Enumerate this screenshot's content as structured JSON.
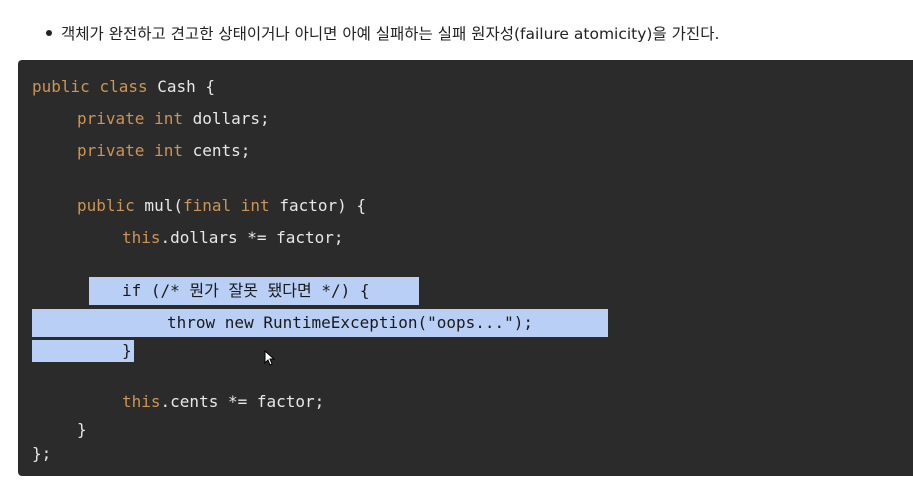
{
  "bullet": {
    "text": "객체가 완전하고 견고한 상태이거나 아니면 아예 실패하는 실패 원자성(failure atomicity)을 가진다."
  },
  "code": {
    "line1": {
      "kw1": "public",
      "kw2": "class",
      "rest": " Cash {"
    },
    "line2": {
      "kw1": "private",
      "kw2": "int",
      "rest": " dollars;"
    },
    "line3": {
      "kw1": "private",
      "kw2": "int",
      "rest": " cents;"
    },
    "line4": {
      "kw1": "public",
      "rest1": " mul(",
      "kw2": "final",
      "kw3": "int",
      "rest2": " factor) {"
    },
    "line5": {
      "kw1": "this",
      "rest": ".dollars *= factor;"
    },
    "line6": {
      "text": "if (/* 뭔가 잘못 됐다면 */) {"
    },
    "line7": {
      "text": "throw new RuntimeException(\"oops...\");"
    },
    "line8": {
      "text": "}"
    },
    "line9": {
      "kw1": "this",
      "rest": ".cents *= factor;"
    },
    "line10": {
      "text": "}"
    },
    "line11": {
      "text": "};"
    }
  },
  "colors": {
    "code_background": "#2b2b2b",
    "keyword": "#cc9552",
    "plain_code": "#e8e8e8",
    "selection": "#b9cff5"
  },
  "icons": {
    "cursor": "mouse-pointer-icon"
  }
}
